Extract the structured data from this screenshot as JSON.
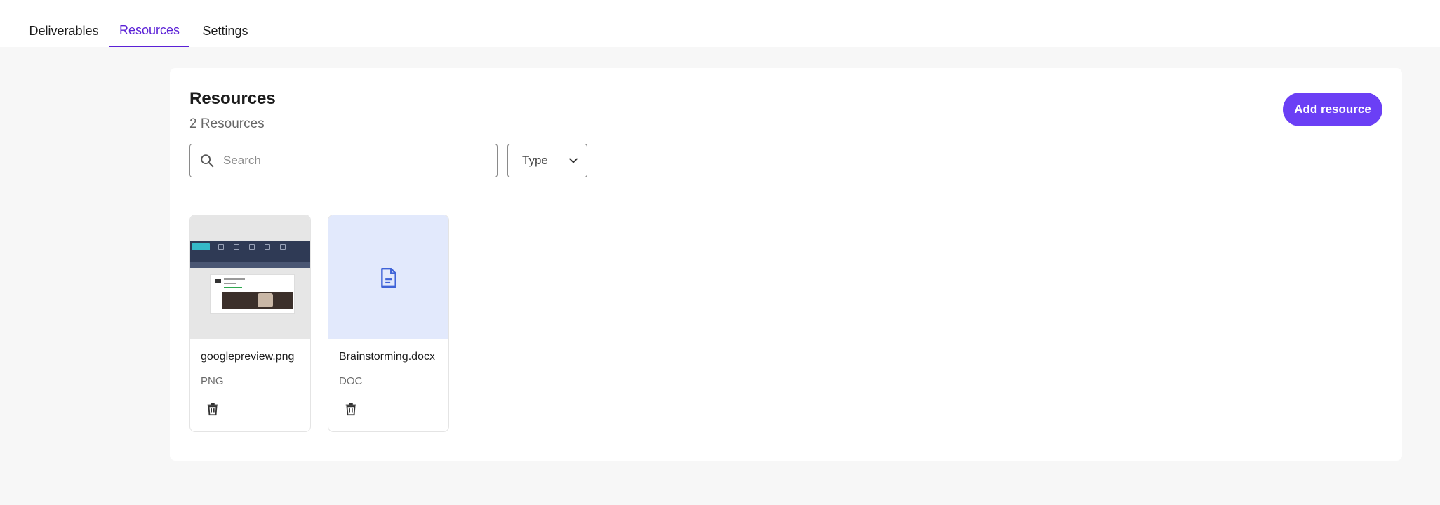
{
  "tabs": {
    "deliverables": "Deliverables",
    "resources": "Resources",
    "settings": "Settings"
  },
  "panel": {
    "title": "Resources",
    "count": "2 Resources",
    "add_button": "Add resource",
    "search_placeholder": "Search",
    "type_filter": "Type"
  },
  "resources": [
    {
      "name": "googlepreview.png",
      "type": "PNG",
      "icon": "image-thumbnail"
    },
    {
      "name": "Brainstorming.docx",
      "type": "DOC",
      "icon": "document-icon"
    }
  ],
  "colors": {
    "accent": "#6b3ff5",
    "active_tab": "#5b21d6",
    "doc_thumb_bg": "#e2e9fc",
    "doc_icon": "#3f63d8"
  }
}
